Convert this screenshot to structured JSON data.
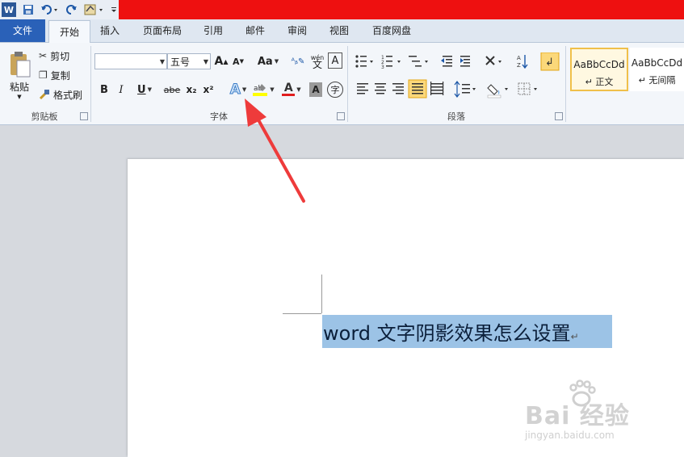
{
  "quick_access": {
    "word_icon": "W"
  },
  "tabs": {
    "file": "文件",
    "home": "开始",
    "insert": "插入",
    "page_layout": "页面布局",
    "references": "引用",
    "mailings": "邮件",
    "review": "审阅",
    "view": "视图",
    "baidu_disk": "百度网盘"
  },
  "clipboard": {
    "paste": "粘贴",
    "cut": "剪切",
    "copy": "复制",
    "format_painter": "格式刷",
    "group": "剪贴板"
  },
  "font": {
    "font_name": "",
    "font_size": "五号",
    "change_case": "Aa",
    "group": "字体",
    "bold": "B",
    "italic": "I",
    "underline": "U",
    "strike": "abe",
    "subscript": "x₂",
    "superscript": "x²",
    "font_color": "A",
    "shading": "A",
    "enclose": "字",
    "phonetic": "wén"
  },
  "paragraph": {
    "group": "段落"
  },
  "styles": {
    "normal_preview": "AaBbCcDd",
    "normal_label": "↵ 正文",
    "nospace_preview": "AaBbCcDd",
    "nospace_label": "↵ 无间隔"
  },
  "document": {
    "text": "word 文字阴影效果怎么设置",
    "para_mark": "↵"
  },
  "watermark": {
    "brand": "Bai  经验",
    "url": "jingyan.baidu.com"
  },
  "colors": {
    "accent": "#2a61b8",
    "title_red": "#ee1010",
    "arrow": "#ee3b3b",
    "selection": "#9cc3e6"
  }
}
